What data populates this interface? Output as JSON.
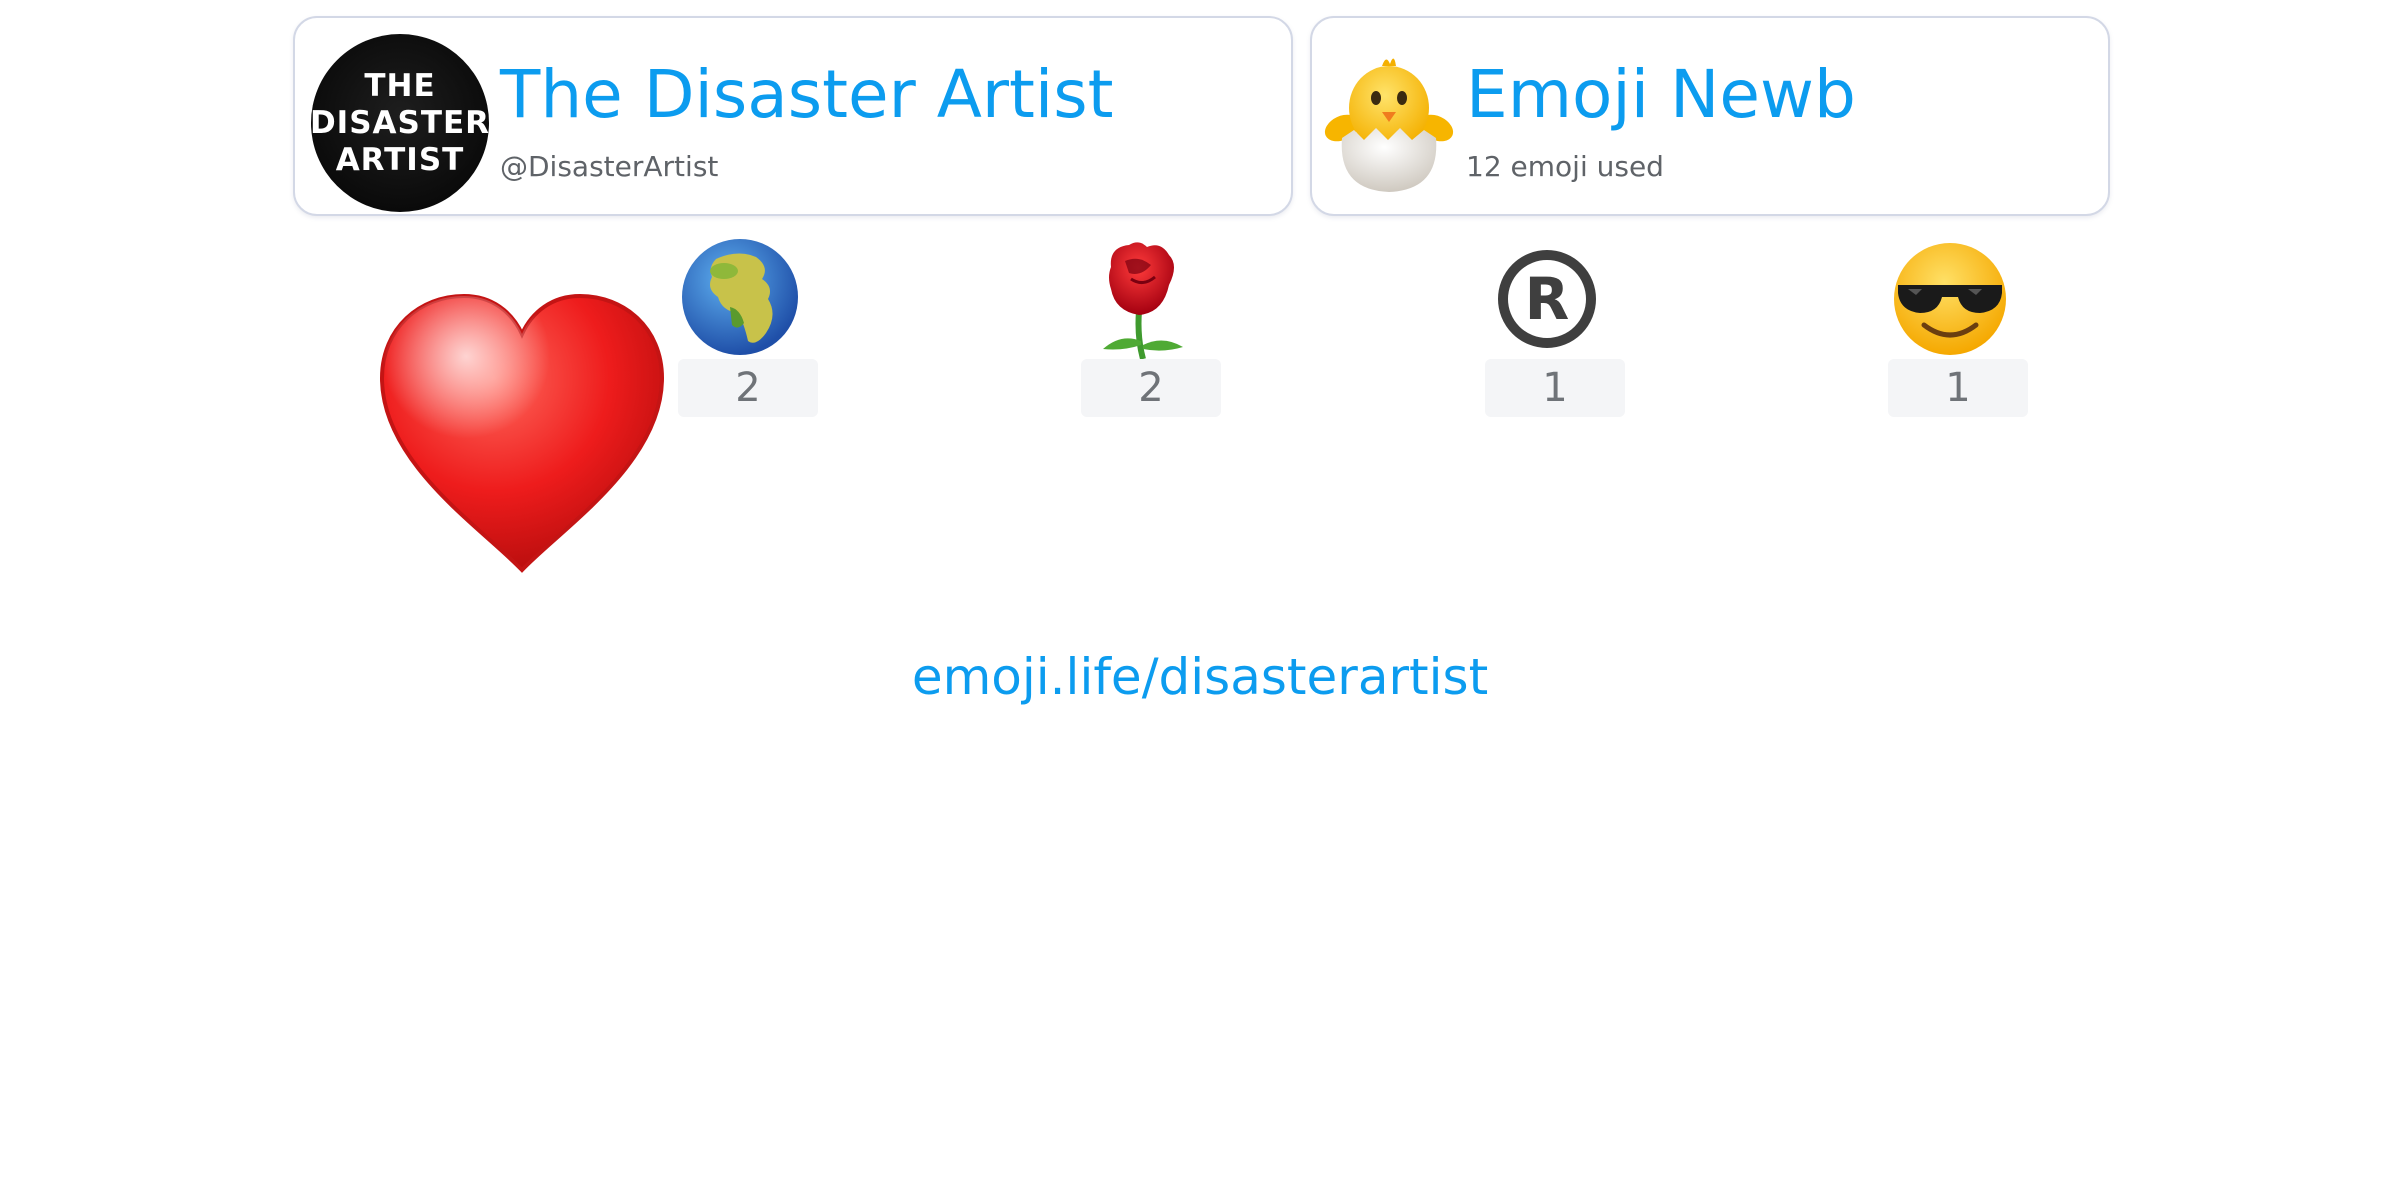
{
  "profile": {
    "avatar_lines": [
      "THE",
      "DISASTER",
      "ARTIST"
    ],
    "name": "The Disaster Artist",
    "handle": "@DisasterArtist"
  },
  "rank": {
    "icon": "hatching-chick-icon",
    "title": "Emoji Newb",
    "subtitle": "12 emoji used"
  },
  "top_emoji": {
    "icon": "red-heart-icon"
  },
  "emoji_counts": [
    {
      "icon": "globe-europe-africa-icon",
      "count": "2"
    },
    {
      "icon": "rose-icon",
      "count": "2"
    },
    {
      "icon": "registered-sign-icon",
      "count": "1"
    },
    {
      "icon": "smiling-face-with-sunglasses-icon",
      "count": "1"
    }
  ],
  "footer": {
    "link": "emoji.life/disasterartist"
  },
  "colors": {
    "accent": "#0c9cef",
    "card_border": "#d3d8e6",
    "count_bg": "#f4f5f7",
    "count_text": "#6f7378",
    "sub_text": "#5f6368"
  }
}
